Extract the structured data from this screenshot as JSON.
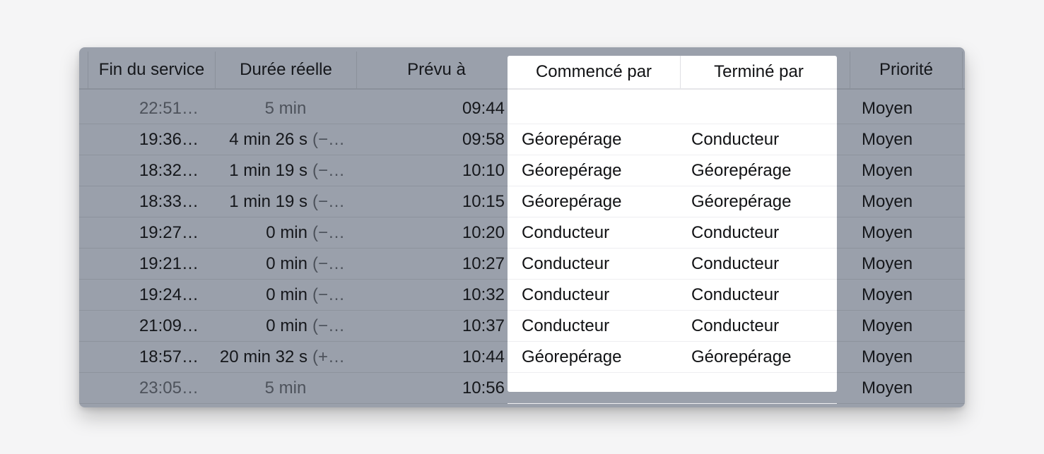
{
  "table": {
    "columns": {
      "end": "Fin du service",
      "duration": "Durée réelle",
      "planned": "Prévu à",
      "started_by": "Commencé par",
      "ended_by": "Terminé par",
      "priority": "Priorité"
    },
    "rows": [
      {
        "end": "22:51…",
        "duration_main": "5 min",
        "duration_delta": "",
        "planned": "09:44",
        "started_by": "",
        "ended_by": "",
        "priority": "Moyen"
      },
      {
        "end": "19:36…",
        "duration_main": "4 min 26 s",
        "duration_delta": "(−…",
        "planned": "09:58",
        "started_by": "Géorepérage",
        "ended_by": "Conducteur",
        "priority": "Moyen"
      },
      {
        "end": "18:32…",
        "duration_main": "1 min 19 s",
        "duration_delta": "(−…",
        "planned": "10:10",
        "started_by": "Géorepérage",
        "ended_by": "Géorepérage",
        "priority": "Moyen"
      },
      {
        "end": "18:33…",
        "duration_main": "1 min 19 s",
        "duration_delta": "(−…",
        "planned": "10:15",
        "started_by": "Géorepérage",
        "ended_by": "Géorepérage",
        "priority": "Moyen"
      },
      {
        "end": "19:27…",
        "duration_main": "0 min",
        "duration_delta": "(−…",
        "planned": "10:20",
        "started_by": "Conducteur",
        "ended_by": "Conducteur",
        "priority": "Moyen"
      },
      {
        "end": "19:21…",
        "duration_main": "0 min",
        "duration_delta": "(−…",
        "planned": "10:27",
        "started_by": "Conducteur",
        "ended_by": "Conducteur",
        "priority": "Moyen"
      },
      {
        "end": "19:24…",
        "duration_main": "0 min",
        "duration_delta": "(−…",
        "planned": "10:32",
        "started_by": "Conducteur",
        "ended_by": "Conducteur",
        "priority": "Moyen"
      },
      {
        "end": "21:09…",
        "duration_main": "0 min",
        "duration_delta": "(−…",
        "planned": "10:37",
        "started_by": "Conducteur",
        "ended_by": "Conducteur",
        "priority": "Moyen"
      },
      {
        "end": "18:57…",
        "duration_main": "20 min 32 s",
        "duration_delta": "(+…",
        "planned": "10:44",
        "started_by": "Géorepérage",
        "ended_by": "Géorepérage",
        "priority": "Moyen"
      },
      {
        "end": "23:05…",
        "duration_main": "5 min",
        "duration_delta": "",
        "planned": "10:56",
        "started_by": "",
        "ended_by": "",
        "priority": "Moyen"
      }
    ],
    "muted_rows": [
      0,
      9
    ]
  },
  "colors": {
    "dim_overlay": "#9aa0ab",
    "highlight_background": "#ffffff",
    "text": "#15171b"
  }
}
